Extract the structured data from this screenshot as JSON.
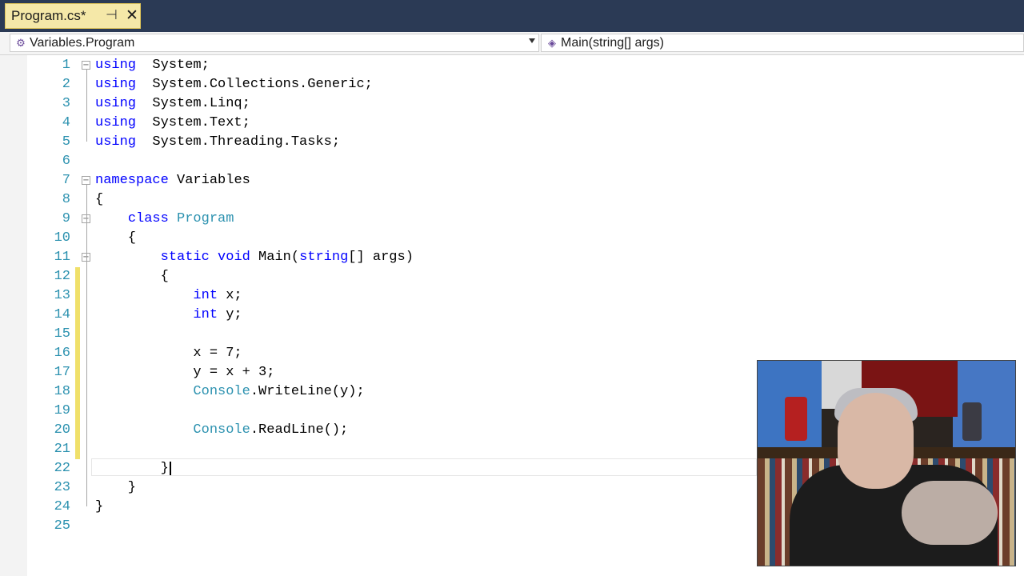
{
  "tab": {
    "title": "Program.cs*",
    "pin_glyph": "⊣",
    "close_glyph": "✕"
  },
  "nav": {
    "left_combo": {
      "label": "Variables.Program",
      "icon": "class-icon"
    },
    "right_combo": {
      "label": "Main(string[] args)",
      "icon": "method-icon"
    }
  },
  "editor": {
    "lines": [
      {
        "n": "1",
        "code": [
          [
            "kw",
            "using"
          ],
          [
            "",
            "  System;"
          ]
        ]
      },
      {
        "n": "2",
        "code": [
          [
            "kw",
            "using"
          ],
          [
            "",
            "  System.Collections.Generic;"
          ]
        ]
      },
      {
        "n": "3",
        "code": [
          [
            "kw",
            "using"
          ],
          [
            "",
            "  System.Linq;"
          ]
        ]
      },
      {
        "n": "4",
        "code": [
          [
            "kw",
            "using"
          ],
          [
            "",
            "  System.Text;"
          ]
        ]
      },
      {
        "n": "5",
        "code": [
          [
            "kw",
            "using"
          ],
          [
            "",
            "  System.Threading.Tasks;"
          ]
        ]
      },
      {
        "n": "6",
        "code": []
      },
      {
        "n": "7",
        "code": [
          [
            "kw",
            "namespace"
          ],
          [
            "",
            " Variables"
          ]
        ]
      },
      {
        "n": "8",
        "code": [
          [
            "",
            "{"
          ]
        ]
      },
      {
        "n": "9",
        "code": [
          [
            "",
            "    "
          ],
          [
            "kw",
            "class"
          ],
          [
            "",
            " "
          ],
          [
            "ty",
            "Program"
          ]
        ]
      },
      {
        "n": "10",
        "code": [
          [
            "",
            "    {"
          ]
        ]
      },
      {
        "n": "11",
        "code": [
          [
            "",
            "        "
          ],
          [
            "kw",
            "static"
          ],
          [
            "",
            " "
          ],
          [
            "kw",
            "void"
          ],
          [
            "",
            " Main("
          ],
          [
            "kw",
            "string"
          ],
          [
            "",
            "[] args)"
          ]
        ]
      },
      {
        "n": "12",
        "code": [
          [
            "",
            "        {"
          ]
        ]
      },
      {
        "n": "13",
        "code": [
          [
            "",
            "            "
          ],
          [
            "kw",
            "int"
          ],
          [
            "",
            " x;"
          ]
        ]
      },
      {
        "n": "14",
        "code": [
          [
            "",
            "            "
          ],
          [
            "kw",
            "int"
          ],
          [
            "",
            " y;"
          ]
        ]
      },
      {
        "n": "15",
        "code": []
      },
      {
        "n": "16",
        "code": [
          [
            "",
            "            x = 7;"
          ]
        ]
      },
      {
        "n": "17",
        "code": [
          [
            "",
            "            y = x + 3;"
          ]
        ]
      },
      {
        "n": "18",
        "code": [
          [
            "",
            "            "
          ],
          [
            "ty",
            "Console"
          ],
          [
            "",
            ".WriteLine(y);"
          ]
        ]
      },
      {
        "n": "19",
        "code": []
      },
      {
        "n": "20",
        "code": [
          [
            "",
            "            "
          ],
          [
            "ty",
            "Console"
          ],
          [
            "",
            ".ReadLine();"
          ]
        ]
      },
      {
        "n": "21",
        "code": []
      },
      {
        "n": "22",
        "code": [
          [
            "",
            "        }"
          ]
        ]
      },
      {
        "n": "23",
        "code": [
          [
            "",
            "    }"
          ]
        ]
      },
      {
        "n": "24",
        "code": [
          [
            "",
            "}"
          ]
        ]
      },
      {
        "n": "25",
        "code": []
      }
    ],
    "changed_lines": [
      "12",
      "13",
      "14",
      "15",
      "16",
      "17",
      "18",
      "19",
      "20",
      "21"
    ],
    "fold_markers": [
      "1",
      "7",
      "9",
      "11"
    ],
    "colors": {
      "keyword": "#0000ff",
      "type": "#2b91af",
      "line_number": "#2b91af",
      "changed": "#f0e06a"
    }
  },
  "webcam": {
    "label": "presenter-webcam"
  }
}
